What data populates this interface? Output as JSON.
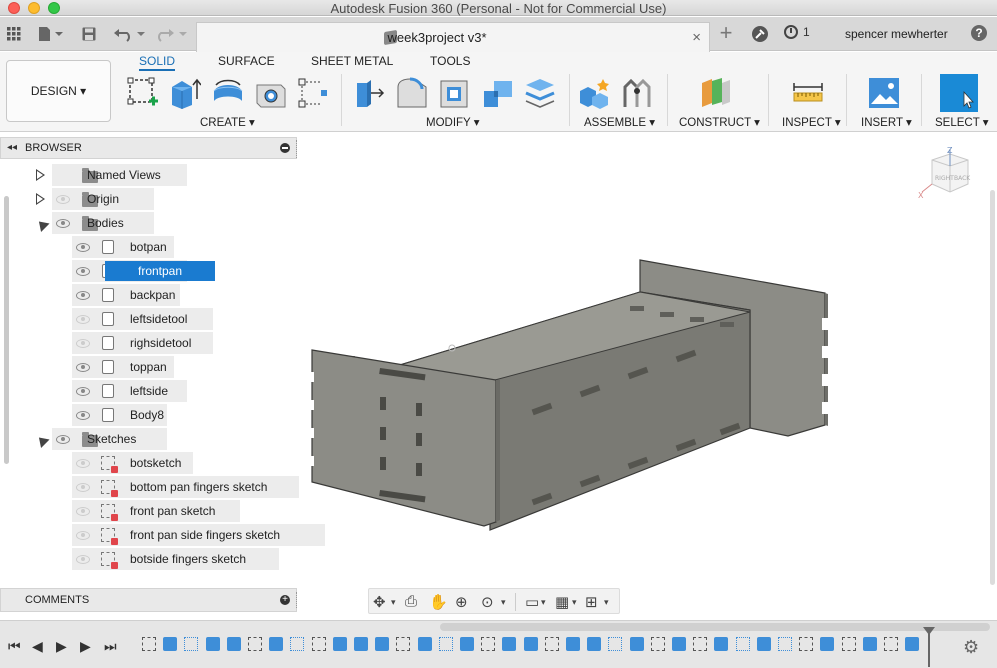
{
  "window": {
    "title": "Autodesk Fusion 360 (Personal - Not for Commercial Use)"
  },
  "document_tab": {
    "title": "week3project v3*",
    "close_symbol": "×"
  },
  "appbar": {
    "new_tab_symbol": "+",
    "jobs_count": "1",
    "user": "spencer mewherter",
    "help_symbol": "?"
  },
  "workspace": {
    "label": "DESIGN ▾"
  },
  "toolbar": {
    "tabs": [
      "SOLID",
      "SURFACE",
      "SHEET METAL",
      "TOOLS"
    ],
    "active_tab": "SOLID",
    "groups": [
      "CREATE ▾",
      "MODIFY ▾",
      "ASSEMBLE ▾",
      "CONSTRUCT ▾",
      "INSPECT ▾",
      "INSERT ▾",
      "SELECT ▾"
    ]
  },
  "browser": {
    "title": "BROWSER",
    "collapse_symbol": "◂◂",
    "items": [
      {
        "label": "Named Views",
        "type": "folder",
        "expander": "right",
        "eye": "none"
      },
      {
        "label": "Origin",
        "type": "folder",
        "expander": "right",
        "eye": "hidden"
      },
      {
        "label": "Bodies",
        "type": "folder",
        "expander": "down",
        "eye": "visible"
      },
      {
        "label": "botpan",
        "type": "body",
        "eye": "visible"
      },
      {
        "label": "frontpan",
        "type": "body",
        "eye": "visible",
        "selected": true
      },
      {
        "label": "backpan",
        "type": "body",
        "eye": "visible"
      },
      {
        "label": "leftsidetool",
        "type": "body",
        "eye": "hidden"
      },
      {
        "label": "righsidetool",
        "type": "body",
        "eye": "hidden"
      },
      {
        "label": "toppan",
        "type": "body",
        "eye": "visible"
      },
      {
        "label": "leftside",
        "type": "body",
        "eye": "visible"
      },
      {
        "label": "Body8",
        "type": "body",
        "eye": "visible"
      },
      {
        "label": "Sketches",
        "type": "folder",
        "expander": "down",
        "eye": "visible"
      },
      {
        "label": "botsketch",
        "type": "sketch",
        "eye": "hidden"
      },
      {
        "label": "bottom pan fingers sketch",
        "type": "sketch",
        "eye": "hidden"
      },
      {
        "label": "front pan sketch",
        "type": "sketch",
        "eye": "hidden"
      },
      {
        "label": "front pan side fingers sketch",
        "type": "sketch",
        "eye": "hidden"
      },
      {
        "label": "botside fingers sketch",
        "type": "sketch",
        "eye": "hidden"
      }
    ]
  },
  "comments": {
    "title": "COMMENTS",
    "add_symbol": "+"
  },
  "viewcube": {
    "face_right": "RIGHT",
    "face_back": "BACK",
    "axis_z": "Z",
    "axis_x": "X"
  },
  "colors": {
    "accent": "#1a7bd0",
    "model": "#8a8a84",
    "toolbar_bg": "#f5f5f5"
  }
}
